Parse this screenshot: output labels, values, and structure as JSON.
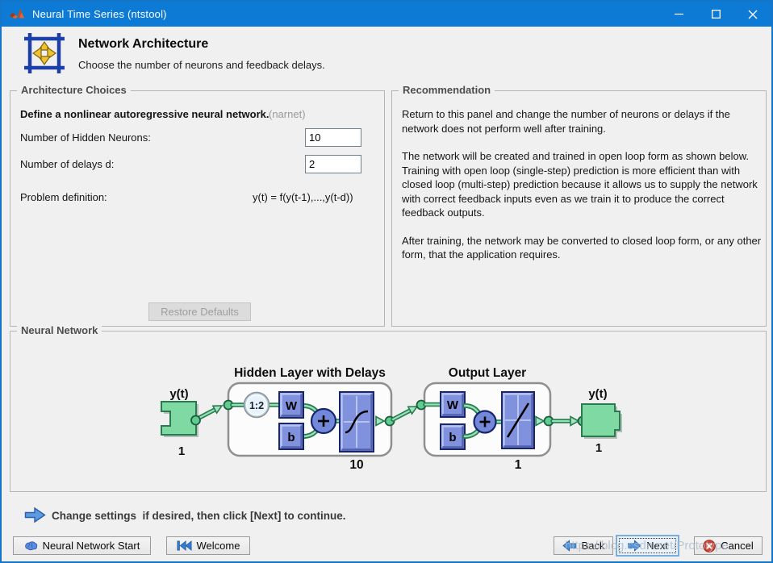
{
  "window": {
    "title": "Neural Time Series (ntstool)"
  },
  "header": {
    "title": "Network Architecture",
    "subtitle": "Choose the number of neurons and feedback delays."
  },
  "architecture": {
    "panel_title": "Architecture Choices",
    "description": "Define a nonlinear autoregressive neural network.",
    "description_tag": "(narnet)",
    "fields": [
      {
        "label": "Number of Hidden Neurons:",
        "value": "10"
      },
      {
        "label": "Number of delays d:",
        "value": "2"
      }
    ],
    "problem_label": "Problem definition:",
    "problem_formula": "y(t) = f(y(t-1),...,y(t-d))",
    "restore_button": "Restore Defaults"
  },
  "recommendation": {
    "panel_title": "Recommendation",
    "paragraphs": [
      "Return to this panel and change the number of neurons or delays if the network does not perform well after training.",
      "The network will be created and trained in open loop form as shown below.  Training with open loop (single-step) prediction is more efficient than with closed loop (multi-step) prediction because it allows us to supply the network with correct feedback inputs even as we train it to produce the correct feedback outputs.",
      "After training, the network may be converted to closed loop form, or any other form, that the application requires."
    ]
  },
  "network": {
    "panel_title": "Neural Network",
    "input": {
      "label": "y(t)",
      "size": "1"
    },
    "hidden": {
      "title": "Hidden Layer with Delays",
      "size": "10",
      "delays": "1:2",
      "weight": "W",
      "bias": "b"
    },
    "output": {
      "title": "Output Layer",
      "size": "1",
      "weight": "W",
      "bias": "b"
    },
    "output_signal": {
      "label": "y(t)",
      "size": "1"
    }
  },
  "footer": {
    "message": "Change settings  if desired, then click [Next] to continue."
  },
  "buttons": {
    "nn_start": "Neural Network Start",
    "welcome": "Welcome",
    "back": "Back",
    "next": "Next",
    "cancel": "Cancel"
  },
  "watermark": "https://blog.csdn.net/Prototype",
  "colors": {
    "titlebar": "#0d7ad5",
    "green_fill": "#7fd9a3",
    "green_dark": "#2c7a4f",
    "blue_fill": "#8091de",
    "blue_dark": "#17266c"
  }
}
